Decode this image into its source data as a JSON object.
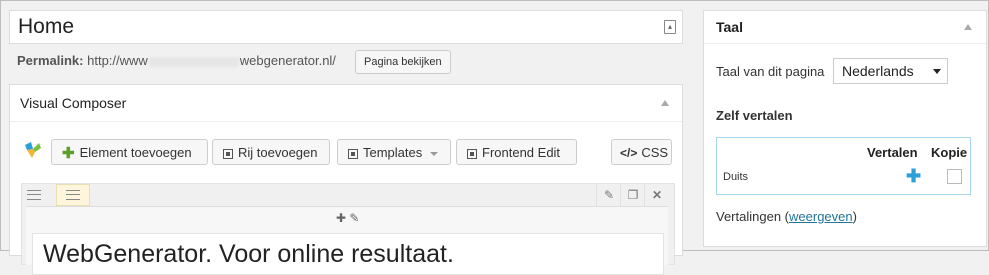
{
  "post": {
    "title": "Home"
  },
  "permalink": {
    "label": "Permalink:",
    "prefix": "http://www",
    "suffix": "webgenerator.nl/",
    "view_button": "Pagina bekijken"
  },
  "visual_composer": {
    "title": "Visual Composer",
    "buttons": {
      "add_element": "Element toevoegen",
      "add_row": "Rij toevoegen",
      "templates": "Templates",
      "frontend_edit": "Frontend Edit",
      "css": "CSS",
      "css_prefix": "</>"
    },
    "element_text": "WebGenerator. Voor online resultaat."
  },
  "sidebar": {
    "title": "Taal",
    "language_label": "Taal van dit pagina",
    "language_value": "Nederlands",
    "self_translate": "Zelf vertalen",
    "table": {
      "col_translate": "Vertalen",
      "col_copy": "Kopie",
      "rows": [
        {
          "language": "Duits"
        }
      ]
    },
    "translations_label": "Vertalingen",
    "translations_link": "weergeven"
  },
  "colors": {
    "accent": "#2e9fd6",
    "add_green": "#5a9f2a",
    "link": "#21759b"
  }
}
